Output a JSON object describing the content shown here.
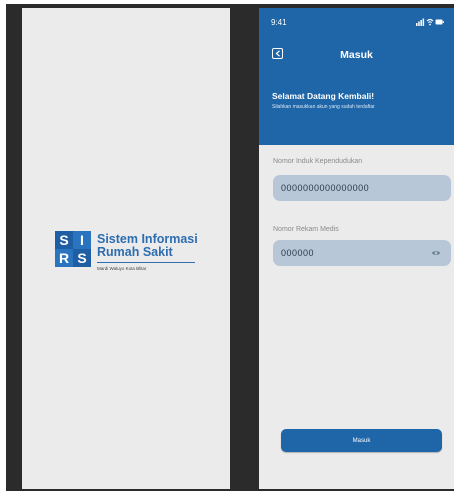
{
  "splash": {
    "logo": {
      "letters": [
        "S",
        "I",
        "R",
        "S"
      ],
      "title_line1": "Sistem Informasi",
      "title_line2": "Rumah Sakit",
      "subtitle": "Mardi Waluyo Kota Blitar"
    }
  },
  "login": {
    "status_time": "9:41",
    "nav_title": "Masuk",
    "welcome_title": "Selamat Datang Kembali!",
    "welcome_sub": "Silahkan masukkan akun yang sudah terdaftar",
    "nik_label": "Nomor Induk Kependudukan",
    "nik_value": "0000000000000000",
    "rm_label": "Nomor Rekam Medis",
    "rm_value": "000000",
    "submit_label": "Masuk"
  },
  "colors": {
    "primary": "#1f66a8",
    "field_bg": "#b7c7d7",
    "screen_bg": "#ebebeb"
  },
  "icons": {
    "back": "chevron-left-icon",
    "password": "eye-icon",
    "signal": "signal-icon",
    "wifi": "wifi-icon",
    "battery": "battery-icon"
  }
}
